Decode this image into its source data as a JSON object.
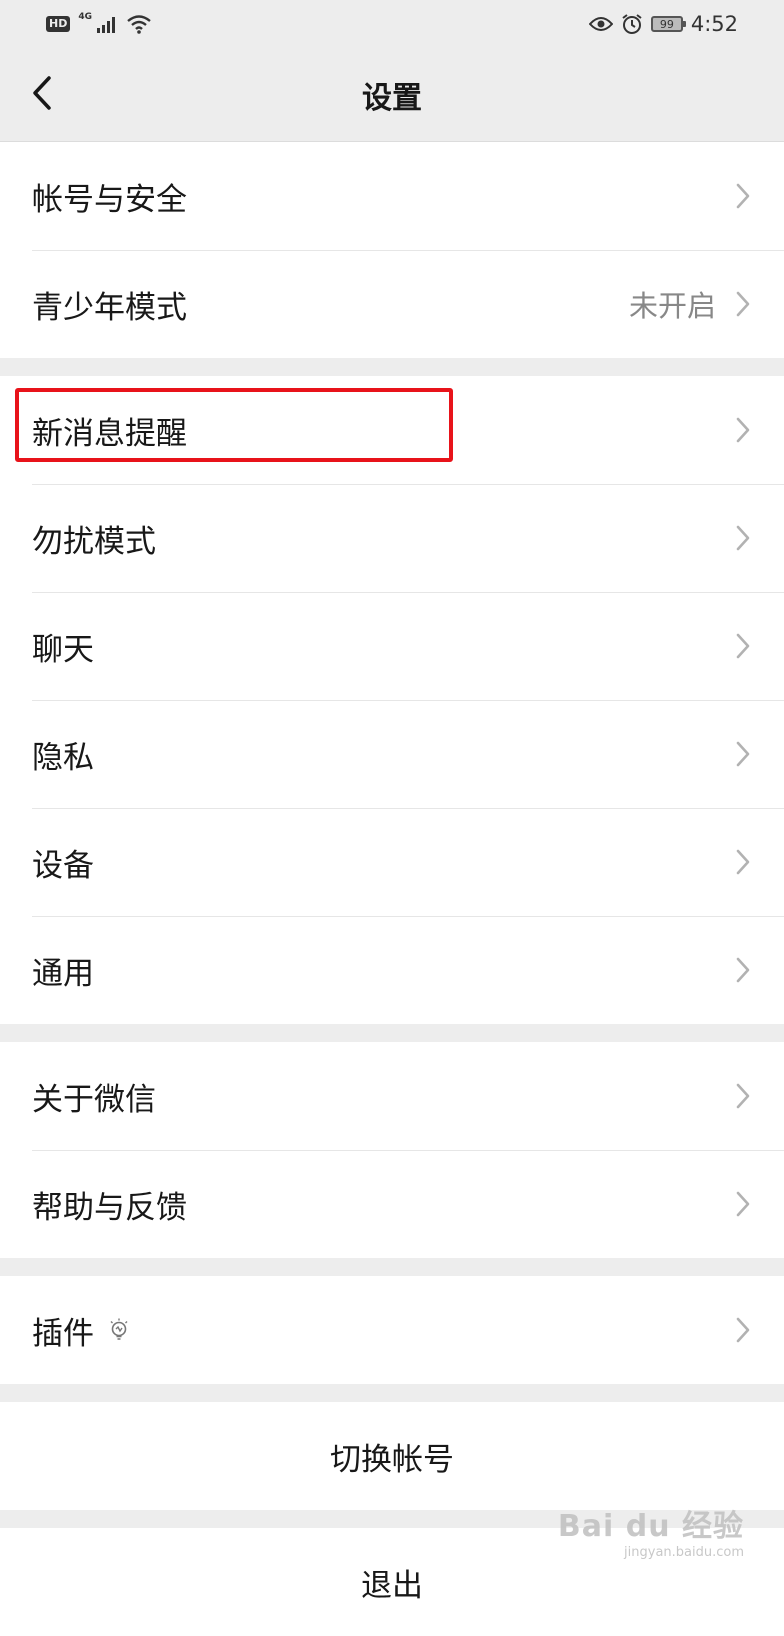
{
  "status_bar": {
    "hd": "HD",
    "network": "4G",
    "battery": "99",
    "time": "4:52"
  },
  "nav": {
    "title": "设置",
    "back_icon": "chevron-left-icon"
  },
  "groups": [
    {
      "items": [
        {
          "label": "帐号与安全",
          "value": ""
        },
        {
          "label": "青少年模式",
          "value": "未开启"
        }
      ]
    },
    {
      "items": [
        {
          "label": "新消息提醒",
          "value": "",
          "highlighted": true
        },
        {
          "label": "勿扰模式",
          "value": ""
        },
        {
          "label": "聊天",
          "value": ""
        },
        {
          "label": "隐私",
          "value": ""
        },
        {
          "label": "设备",
          "value": ""
        },
        {
          "label": "通用",
          "value": ""
        }
      ]
    },
    {
      "items": [
        {
          "label": "关于微信",
          "value": ""
        },
        {
          "label": "帮助与反馈",
          "value": ""
        }
      ]
    },
    {
      "items": [
        {
          "label": "插件",
          "value": "",
          "icon": "lightbulb-icon"
        }
      ]
    }
  ],
  "actions": {
    "switch_account": "切换帐号",
    "logout": "退出"
  },
  "watermark": {
    "main": "Bai du 经验",
    "sub": "jingyan.baidu.com"
  },
  "colors": {
    "background": "#ededed",
    "highlight": "#e8131a",
    "secondary_text": "#888888"
  }
}
